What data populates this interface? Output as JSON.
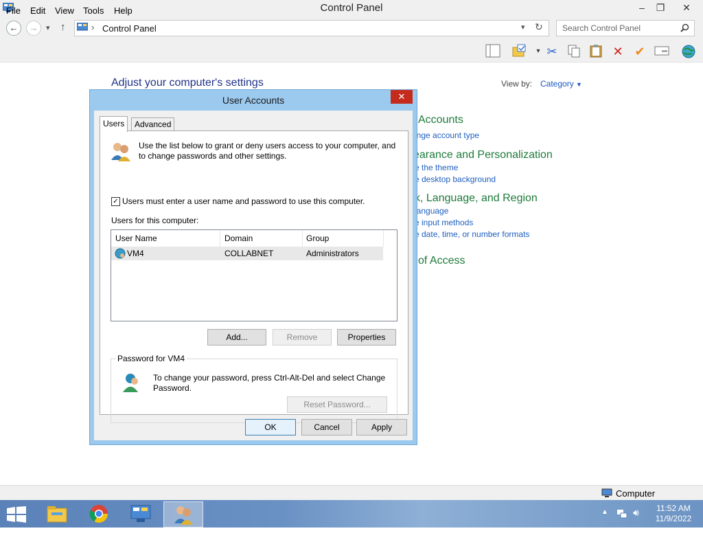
{
  "window": {
    "title": "Control Panel",
    "minimize": "–",
    "restore": "❐",
    "close": "✕"
  },
  "nav": {
    "back": "←",
    "forward": "→",
    "dropdown": "▾",
    "up": "↑",
    "address_sep": "›",
    "address": "Control Panel",
    "refresh": "↻",
    "search_placeholder": "Search Control Panel"
  },
  "menu": [
    "File",
    "Edit",
    "View",
    "Tools",
    "Help"
  ],
  "content": {
    "heading": "Adjust your computer's settings",
    "view_by_label": "View by:",
    "view_by_value": "Category",
    "categories": [
      {
        "title": "Accounts",
        "links": [
          "ange account type"
        ]
      },
      {
        "title": "earance and Personalization",
        "links": [
          "e the theme",
          "e desktop background"
        ]
      },
      {
        "title": "k, Language, and Region",
        "links": [
          "language",
          "e input methods",
          "e date, time, or number formats"
        ]
      },
      {
        "title": "of Access",
        "links": []
      }
    ]
  },
  "dialog": {
    "title": "User Accounts",
    "close": "✕",
    "tabs": [
      "Users",
      "Advanced"
    ],
    "intro": "Use the list below to grant or deny users access to your computer, and to change passwords and other settings.",
    "checkbox_label": "Users must enter a user name and password to use this computer.",
    "checkbox_mark": "✓",
    "users_label": "Users for this computer:",
    "columns": [
      "User Name",
      "Domain",
      "Group"
    ],
    "users": [
      {
        "name": "VM4",
        "domain": "COLLABNET",
        "group": "Administrators"
      }
    ],
    "add": "Add...",
    "remove": "Remove",
    "properties": "Properties",
    "password_group": "Password for VM4",
    "password_text": "To change your password, press Ctrl-Alt-Del and select Change Password.",
    "reset": "Reset Password...",
    "ok": "OK",
    "cancel": "Cancel",
    "apply": "Apply"
  },
  "status": {
    "computer": "Computer"
  },
  "clock": {
    "time": "11:52 AM",
    "date": "11/9/2022"
  }
}
